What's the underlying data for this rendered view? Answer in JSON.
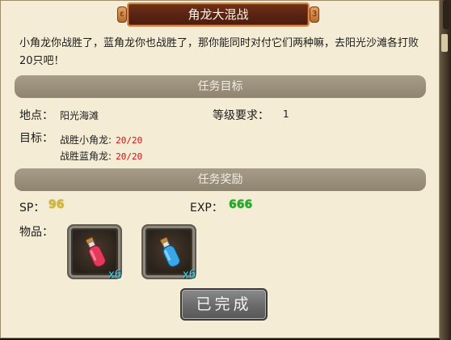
{
  "quest": {
    "title": "角龙大混战",
    "description": "小角龙你战胜了，蓝角龙你也战胜了，那你能同时对付它们两种嘛，去阳光沙滩各打败20只吧！",
    "goal_header": "任务目标",
    "location_label": "地点：",
    "location_value": "阳光海滩",
    "level_label": "等级要求：",
    "level_value": "1",
    "target_label": "目标：",
    "targets": [
      {
        "name": "战胜小角龙:",
        "progress": "20/20"
      },
      {
        "name": "战胜蓝角龙:",
        "progress": "20/20"
      }
    ],
    "reward_header": "任务奖励",
    "sp_label": "SP：",
    "sp_value": "96",
    "exp_label": "EXP：",
    "exp_value": "666",
    "items_label": "物品：",
    "items": [
      {
        "icon": "red-potion-icon",
        "qty": "x6",
        "color": "#e23a5a"
      },
      {
        "icon": "blue-potion-icon",
        "qty": "x6",
        "color": "#3aa8e8"
      }
    ],
    "complete_button": "已完成"
  },
  "colors": {
    "panel_bg": "#f4ecd5",
    "header_bar": "#9c917c",
    "progress_red": "#d01010",
    "sp_yellow": "#d7b82a",
    "exp_green": "#18b020",
    "qty_cyan": "#38d4ee"
  }
}
